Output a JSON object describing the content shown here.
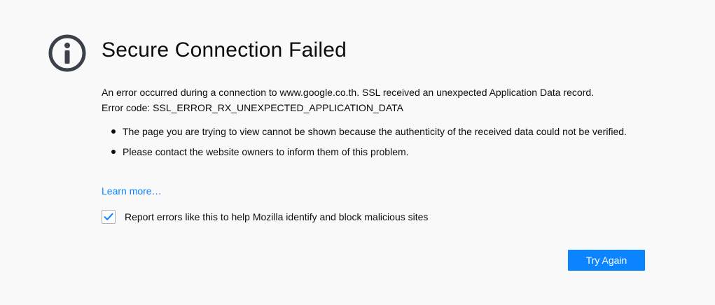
{
  "page": {
    "title": "Secure Connection Failed",
    "icon": "info-icon",
    "icon_color": "#3b4049"
  },
  "description": {
    "line1": "An error occurred during a connection to www.google.co.th. SSL received an unexpected Application Data record.",
    "line2": "Error code: SSL_ERROR_RX_UNEXPECTED_APPLICATION_DATA"
  },
  "details": [
    "The page you are trying to view cannot be shown because the authenticity of the received data could not be verified.",
    "Please contact the website owners to inform them of this problem."
  ],
  "learn_more": {
    "label": "Learn more…",
    "color": "#0a84ff"
  },
  "report": {
    "label": "Report errors like this to help Mozilla identify and block malicious sites",
    "checked": true
  },
  "actions": {
    "try_again_label": "Try Again",
    "accent_color": "#0a84ff"
  }
}
